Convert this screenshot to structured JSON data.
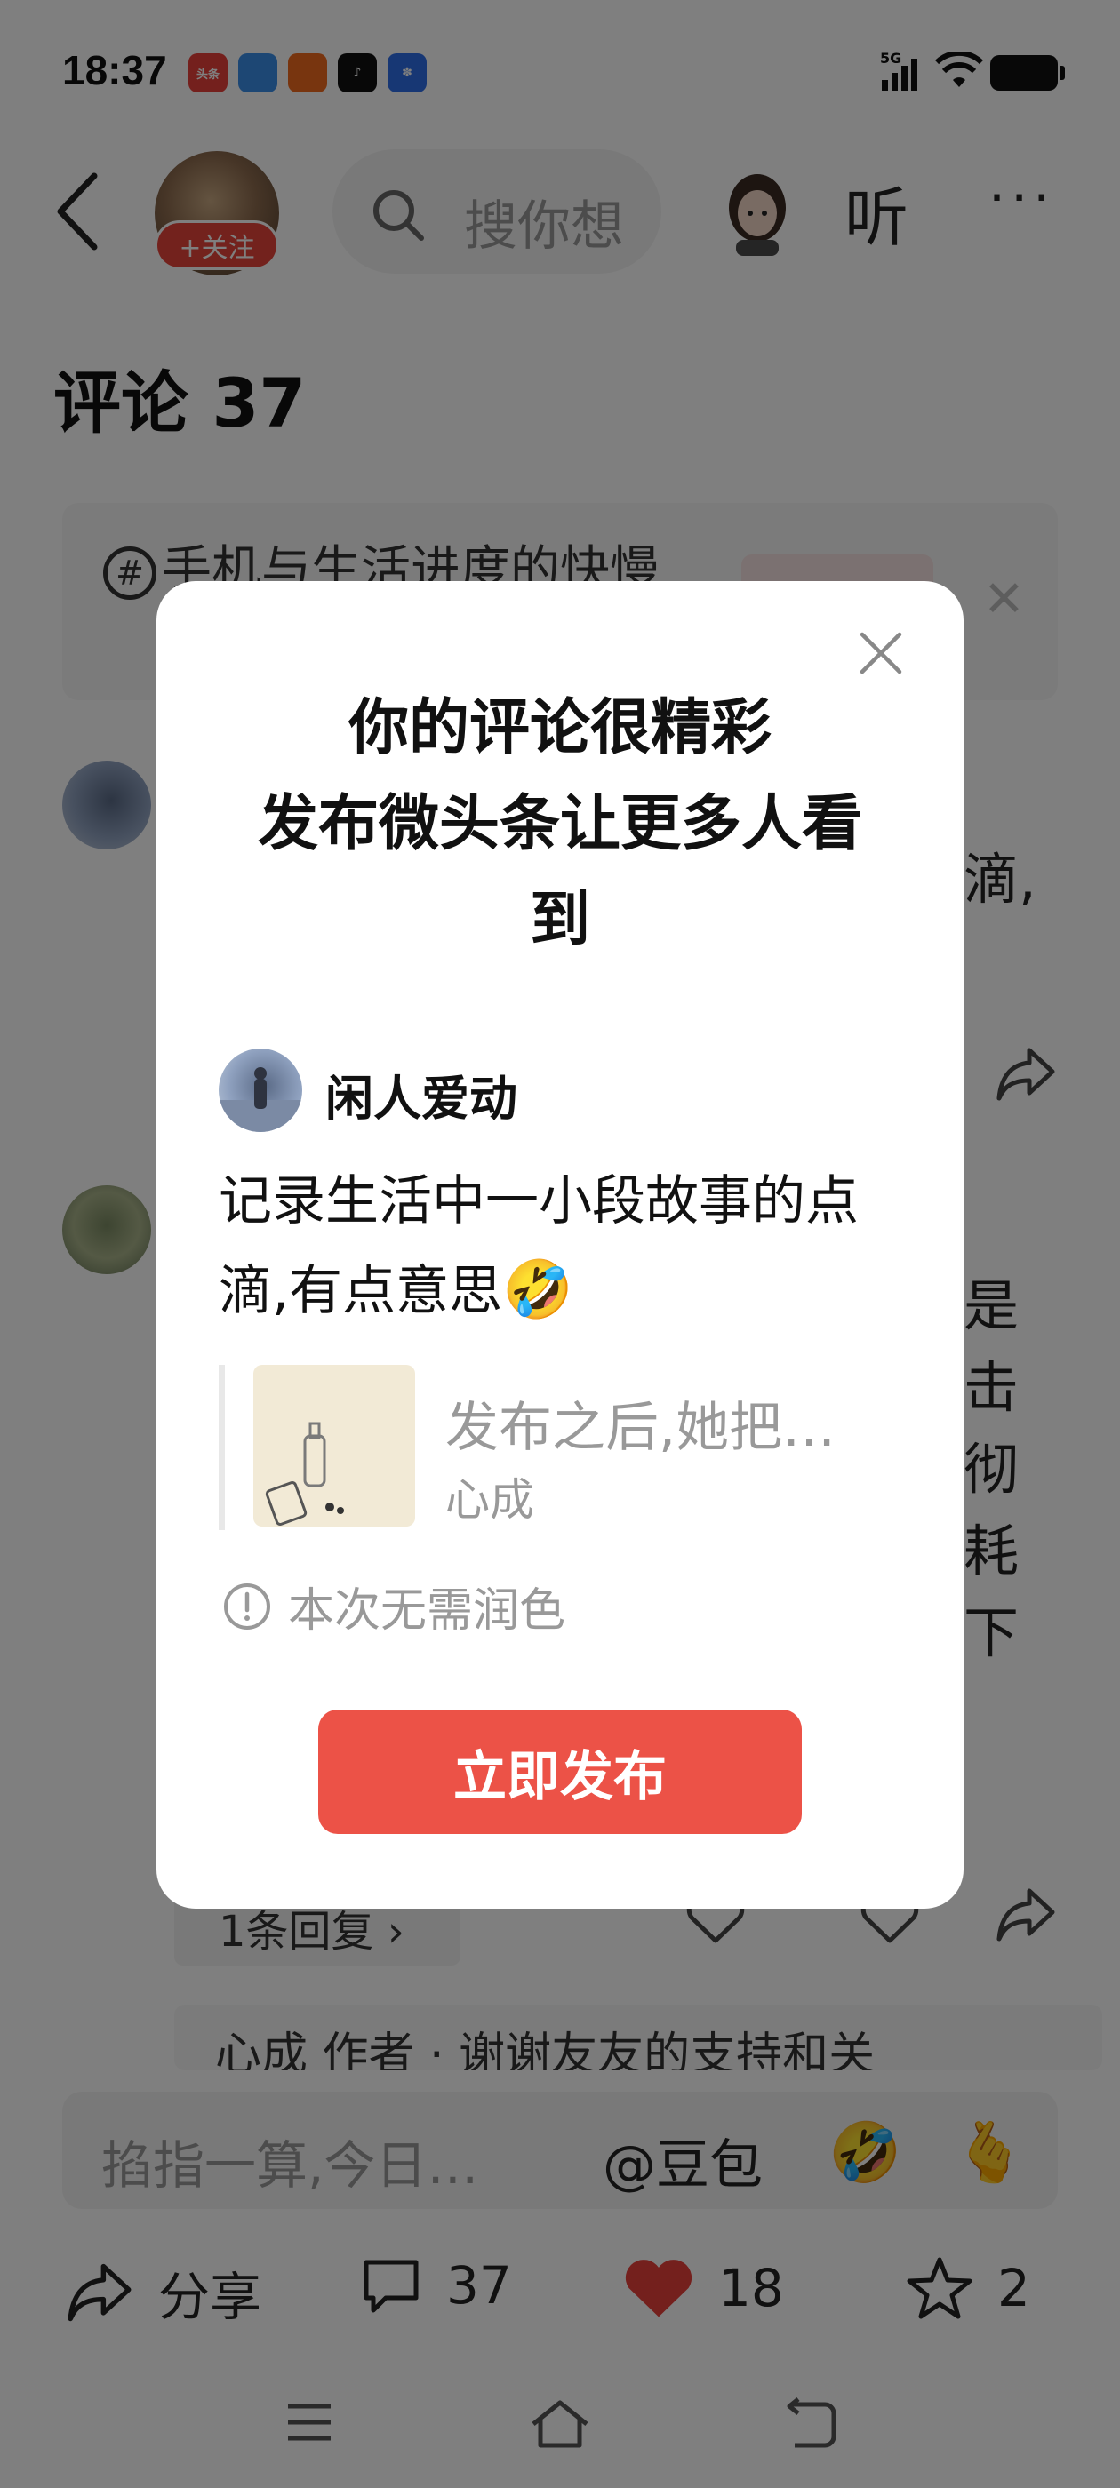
{
  "status_bar": {
    "time": "18:37",
    "network": "5G",
    "app_icons": [
      {
        "name": "toutiao-icon",
        "label": "头条",
        "color": "#e8413a"
      },
      {
        "name": "app-blue-icon",
        "label": "",
        "color": "#3a8ee8"
      },
      {
        "name": "app-orange-icon",
        "label": "",
        "color": "#f06a1e"
      },
      {
        "name": "tiktok-icon",
        "label": "",
        "color": "#111111"
      },
      {
        "name": "baidu-icon",
        "label": "",
        "color": "#2f6fe8"
      }
    ]
  },
  "header": {
    "follow_label": "+关注",
    "search_placeholder": "搜你想",
    "listen_label": "听",
    "more_label": "···"
  },
  "comments": {
    "title": "评论 37",
    "topic_text": "手机与生活进度的快慢",
    "background_snippets": [
      "滴,",
      "是",
      "击",
      "彻",
      "耗",
      "下"
    ],
    "reply_count_label": "1条回复 ›",
    "reply_preview": "心成 作者 · 谢谢友友的支持和关"
  },
  "input_bar": {
    "placeholder": "掐指一算,今日…",
    "at_label": "@豆包",
    "emoji_1": "🤣",
    "emoji_2": "🫰"
  },
  "actions": {
    "share_label": "分享",
    "comment_count": "37",
    "like_count": "18",
    "favorite_count": "2"
  },
  "modal": {
    "title_line1": "你的评论很精彩",
    "title_line2": "发布微头条让更多人看",
    "title_line3": "到",
    "username": "闲人爱动",
    "comment": "记录生活中一小段故事的点滴,有点意思",
    "comment_emoji": "🤣",
    "quote_title": "发布之后,她把…",
    "quote_author": "心成",
    "notice": "本次无需润色",
    "publish_label": "立即发布"
  },
  "colors": {
    "accent_red": "#ec5247",
    "follow_red": "#e6453a",
    "like_red": "#e8413a"
  }
}
